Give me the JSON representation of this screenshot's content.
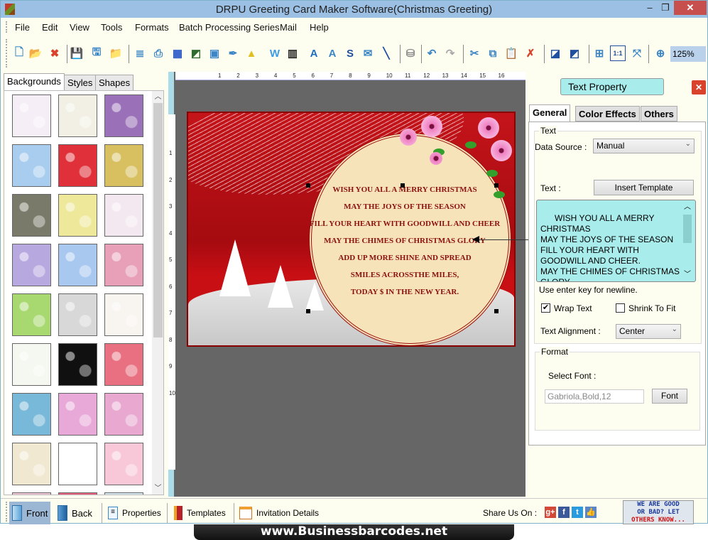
{
  "window": {
    "title": "DRPU Greeting Card Maker Software(Christmas Greeting)",
    "minimize": "‒",
    "maximize": "❐",
    "close": "✕"
  },
  "menu": [
    "File",
    "Edit",
    "View",
    "Tools",
    "Formats",
    "Batch Processing Series",
    "Mail",
    "Help"
  ],
  "toolbar": {
    "buttons": [
      {
        "name": "new-icon",
        "glyph": "🗋",
        "color": "#3c86c6"
      },
      {
        "name": "open-icon",
        "glyph": "📂",
        "color": "#e0a030"
      },
      {
        "name": "close-file-icon",
        "glyph": "✖",
        "color": "#d9432b"
      },
      {
        "name": "save-icon",
        "glyph": "💾",
        "color": "#3c86c6"
      },
      {
        "name": "save-as-icon",
        "glyph": "🖫",
        "color": "#3c86c6"
      },
      {
        "name": "export-icon",
        "glyph": "📁",
        "color": "#e0a030"
      },
      {
        "name": "properties-icon",
        "glyph": "≣",
        "color": "#3c86c6"
      },
      {
        "name": "print-icon",
        "glyph": "⎙",
        "color": "#3c86c6"
      },
      {
        "name": "layers-icon",
        "glyph": "▦",
        "color": "#2a56c6"
      },
      {
        "name": "background-icon",
        "glyph": "◩",
        "color": "#2f6b2f"
      },
      {
        "name": "insert-image-icon",
        "glyph": "▣",
        "color": "#3c86c6"
      },
      {
        "name": "pen-icon",
        "glyph": "✒",
        "color": "#3c86c6"
      },
      {
        "name": "shapes-icon",
        "glyph": "▲",
        "color": "#e0c020"
      },
      {
        "name": "wordart-icon",
        "glyph": "W",
        "color": "#3c9ce6"
      },
      {
        "name": "barcode-icon",
        "glyph": "▥",
        "color": "#222"
      },
      {
        "name": "text-icon",
        "glyph": "A",
        "color": "#1f6fbf"
      },
      {
        "name": "text-doc-icon",
        "glyph": "A",
        "color": "#3c86c6"
      },
      {
        "name": "signature-icon",
        "glyph": "S",
        "color": "#1f4f9f"
      },
      {
        "name": "mail-icon",
        "glyph": "✉",
        "color": "#3c86c6"
      },
      {
        "name": "line-icon",
        "glyph": "╲",
        "color": "#1f4f9f"
      },
      {
        "name": "database-icon",
        "glyph": "⛁",
        "color": "#888"
      },
      {
        "name": "undo-icon",
        "glyph": "↶",
        "color": "#3c86c6"
      },
      {
        "name": "redo-icon",
        "glyph": "↷",
        "color": "#aaa"
      },
      {
        "name": "cut-icon",
        "glyph": "✂",
        "color": "#3c86c6"
      },
      {
        "name": "copy-icon",
        "glyph": "⧉",
        "color": "#3c86c6"
      },
      {
        "name": "paste-icon",
        "glyph": "📋",
        "color": "#c08040"
      },
      {
        "name": "delete-icon",
        "glyph": "✗",
        "color": "#d9432b"
      },
      {
        "name": "bring-front-icon",
        "glyph": "◪",
        "color": "#1f4f9f"
      },
      {
        "name": "send-back-icon",
        "glyph": "◩",
        "color": "#1f4f9f"
      },
      {
        "name": "grid-icon",
        "glyph": "⊞",
        "color": "#3c86c6"
      },
      {
        "name": "actual-size-icon",
        "glyph": "1:1",
        "color": "#1f4f9f"
      },
      {
        "name": "fit-window-icon",
        "glyph": "⤧",
        "color": "#3c86c6"
      },
      {
        "name": "zoom-in-icon",
        "glyph": "⊕",
        "color": "#3c86c6"
      }
    ],
    "zoom_value": "125%"
  },
  "left_panel": {
    "tabs": [
      "Backgrounds",
      "Styles",
      "Shapes"
    ],
    "active_tab": "Backgrounds",
    "thumbnails": [
      {
        "name": "baby-pink-pattern",
        "bg": "#f6eef6"
      },
      {
        "name": "baby-doodle-pattern",
        "bg": "#f2f0e4"
      },
      {
        "name": "purple-flowers-pattern",
        "bg": "#9a70b8"
      },
      {
        "name": "clouds-pattern",
        "bg": "#a8cdee"
      },
      {
        "name": "strawberry-pattern",
        "bg": "#e0303a"
      },
      {
        "name": "leaves-pattern",
        "bg": "#d8c060"
      },
      {
        "name": "grey-roses-pattern",
        "bg": "#7a7a6a"
      },
      {
        "name": "colorful-dots-pattern",
        "bg": "#eee89a"
      },
      {
        "name": "gifts-pattern",
        "bg": "#f4e8f0"
      },
      {
        "name": "pastel-circles-pattern",
        "bg": "#b8a8e0"
      },
      {
        "name": "snowflakes-pattern",
        "bg": "#a8c8f0"
      },
      {
        "name": "mandala-pattern",
        "bg": "#e8a0b8"
      },
      {
        "name": "green-trees-pattern",
        "bg": "#a8d870"
      },
      {
        "name": "white-heart-pattern",
        "bg": "#d8d8d8"
      },
      {
        "name": "kids-doodle-pattern",
        "bg": "#f8f4f0"
      },
      {
        "name": "green-ornament-pattern",
        "bg": "#f4f8f0"
      },
      {
        "name": "fireworks-pattern",
        "bg": "#101010"
      },
      {
        "name": "red-hearts-pattern",
        "bg": "#e87080"
      },
      {
        "name": "santa-pattern",
        "bg": "#78b8d8"
      },
      {
        "name": "pink-bokeh-pattern",
        "bg": "#e8a8d8"
      },
      {
        "name": "pinwheel-pattern",
        "bg": "#e8a8d0"
      },
      {
        "name": "pastel-stripes-pattern",
        "bg": "#f0e8d0"
      },
      {
        "name": "teddy-bear-pattern",
        "bg": "#ffffff"
      },
      {
        "name": "pink-dress-pattern",
        "bg": "#f8c8d8"
      }
    ]
  },
  "canvas": {
    "ruler_h": [
      "1",
      "2",
      "3",
      "4",
      "5",
      "6",
      "7",
      "8",
      "9",
      "10",
      "11",
      "12",
      "13",
      "14",
      "15",
      "16"
    ],
    "ruler_v": [
      "1",
      "2",
      "3",
      "4",
      "5",
      "6",
      "7",
      "8",
      "9",
      "10"
    ],
    "card_text": [
      "WISH YOU ALL A MERRY CHRISTMAS",
      "MAY THE JOYS OF THE SEASON",
      "FILL YOUR HEART WITH GOODWILL AND CHEER",
      "MAY THE CHIMES OF CHRISTMAS GLORY",
      "ADD UP MORE SHINE AND SPREAD",
      "SMILES ACROSSTHE MILES,",
      "TODAY $ IN THE NEW YEAR."
    ]
  },
  "right_panel": {
    "title": "Text Property",
    "tabs": [
      "General",
      "Color Effects",
      "Others"
    ],
    "active_tab": "General",
    "text_group_label": "Text",
    "data_source_label": "Data Source :",
    "data_source_value": "Manual",
    "text_label": "Text :",
    "insert_template_label": "Insert Template",
    "text_value": "WISH YOU ALL A MERRY\nCHRISTMAS\nMAY THE JOYS OF THE SEASON\nFILL YOUR HEART WITH\nGOODWILL AND CHEER.\nMAY THE CHIMES OF CHRISTMAS\nGLORY",
    "hint": "Use enter key for newline.",
    "wrap_text_label": "Wrap Text",
    "wrap_text_checked": true,
    "shrink_to_fit_label": "Shrink To Fit",
    "shrink_to_fit_checked": false,
    "alignment_label": "Text Alignment :",
    "alignment_value": "Center",
    "format_group_label": "Format",
    "select_font_label": "Select Font :",
    "font_value": "Gabriola,Bold,12",
    "font_button": "Font"
  },
  "bottom_bar": {
    "buttons": [
      {
        "name": "front",
        "label": "Front",
        "active": true
      },
      {
        "name": "back",
        "label": "Back",
        "active": false
      },
      {
        "name": "properties",
        "label": "Properties",
        "active": false
      },
      {
        "name": "templates",
        "label": "Templates",
        "active": false
      },
      {
        "name": "invitation-details",
        "label": "Invitation Details",
        "active": false
      }
    ],
    "share_label": "Share Us On :",
    "social": [
      {
        "name": "google-plus-icon",
        "glyph": "g+",
        "color": "#d34836"
      },
      {
        "name": "facebook-icon",
        "glyph": "f",
        "color": "#3b5998"
      },
      {
        "name": "twitter-icon",
        "glyph": "t",
        "color": "#2b9be0"
      },
      {
        "name": "like-icon",
        "glyph": "👍",
        "color": "#5b86c6"
      }
    ],
    "feedback_lines": [
      "WE ARE GOOD",
      "OR BAD? LET",
      "OTHERS KNOW..."
    ]
  },
  "watermark": "www.Businessbarcodes.net"
}
